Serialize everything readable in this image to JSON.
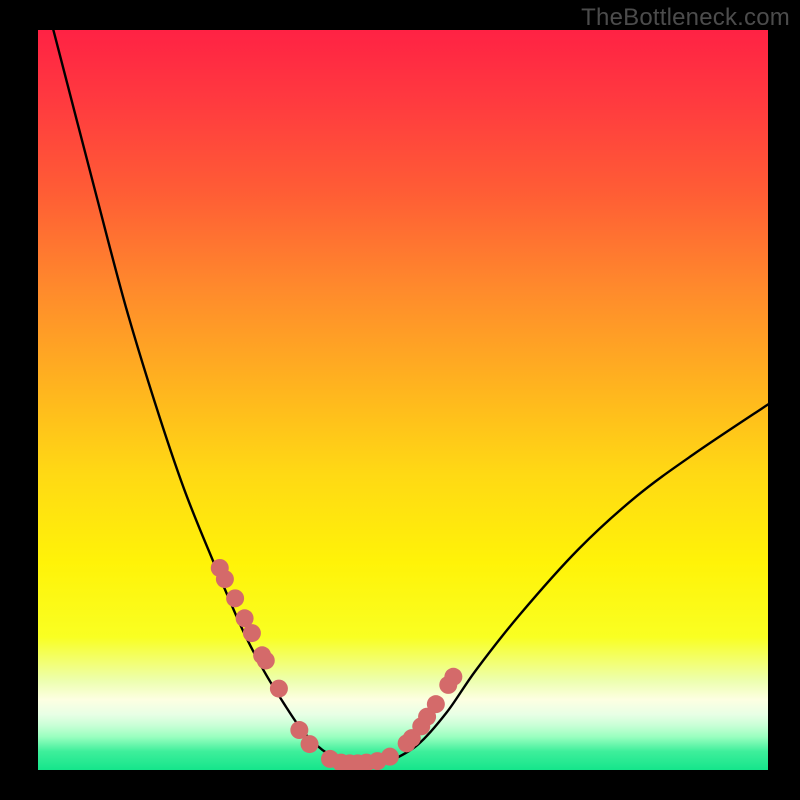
{
  "attribution": "TheBottleneck.com",
  "colors": {
    "curve_stroke": "#000000",
    "marker_fill": "#d46a6a",
    "frame_bg": "#000000"
  },
  "gradient_stops": [
    {
      "offset": 0.0,
      "color": "#ff2244"
    },
    {
      "offset": 0.1,
      "color": "#ff3b3f"
    },
    {
      "offset": 0.22,
      "color": "#ff5d35"
    },
    {
      "offset": 0.35,
      "color": "#ff8a2c"
    },
    {
      "offset": 0.48,
      "color": "#ffb31f"
    },
    {
      "offset": 0.6,
      "color": "#ffd914"
    },
    {
      "offset": 0.72,
      "color": "#fff308"
    },
    {
      "offset": 0.82,
      "color": "#f9ff22"
    },
    {
      "offset": 0.88,
      "color": "#edffb0"
    },
    {
      "offset": 0.905,
      "color": "#fdffe2"
    },
    {
      "offset": 0.925,
      "color": "#e8ffe5"
    },
    {
      "offset": 0.94,
      "color": "#c8ffd6"
    },
    {
      "offset": 0.955,
      "color": "#9affc0"
    },
    {
      "offset": 0.975,
      "color": "#3eef9b"
    },
    {
      "offset": 1.0,
      "color": "#15e58b"
    }
  ],
  "chart_data": {
    "type": "line",
    "title": "",
    "xlabel": "",
    "ylabel": "",
    "xlim": [
      0,
      1
    ],
    "ylim": [
      0,
      1
    ],
    "x": [
      0.0,
      0.04,
      0.08,
      0.12,
      0.16,
      0.2,
      0.24,
      0.28,
      0.31,
      0.34,
      0.36,
      0.38,
      0.4,
      0.42,
      0.44,
      0.46,
      0.48,
      0.52,
      0.56,
      0.6,
      0.66,
      0.74,
      0.82,
      0.9,
      1.0
    ],
    "y": [
      1.08,
      0.928,
      0.776,
      0.627,
      0.497,
      0.38,
      0.282,
      0.19,
      0.133,
      0.085,
      0.056,
      0.035,
      0.02,
      0.01,
      0.007,
      0.007,
      0.011,
      0.034,
      0.078,
      0.135,
      0.21,
      0.298,
      0.37,
      0.428,
      0.494
    ],
    "markers": {
      "x": [
        0.249,
        0.256,
        0.27,
        0.283,
        0.293,
        0.307,
        0.312,
        0.33,
        0.358,
        0.372,
        0.4,
        0.415,
        0.427,
        0.438,
        0.45,
        0.465,
        0.482,
        0.505,
        0.512,
        0.525,
        0.533,
        0.545,
        0.562,
        0.569
      ],
      "y": [
        0.273,
        0.258,
        0.232,
        0.205,
        0.185,
        0.155,
        0.148,
        0.11,
        0.054,
        0.035,
        0.015,
        0.01,
        0.009,
        0.009,
        0.01,
        0.012,
        0.018,
        0.036,
        0.043,
        0.059,
        0.072,
        0.089,
        0.115,
        0.126
      ],
      "r": 9
    }
  }
}
